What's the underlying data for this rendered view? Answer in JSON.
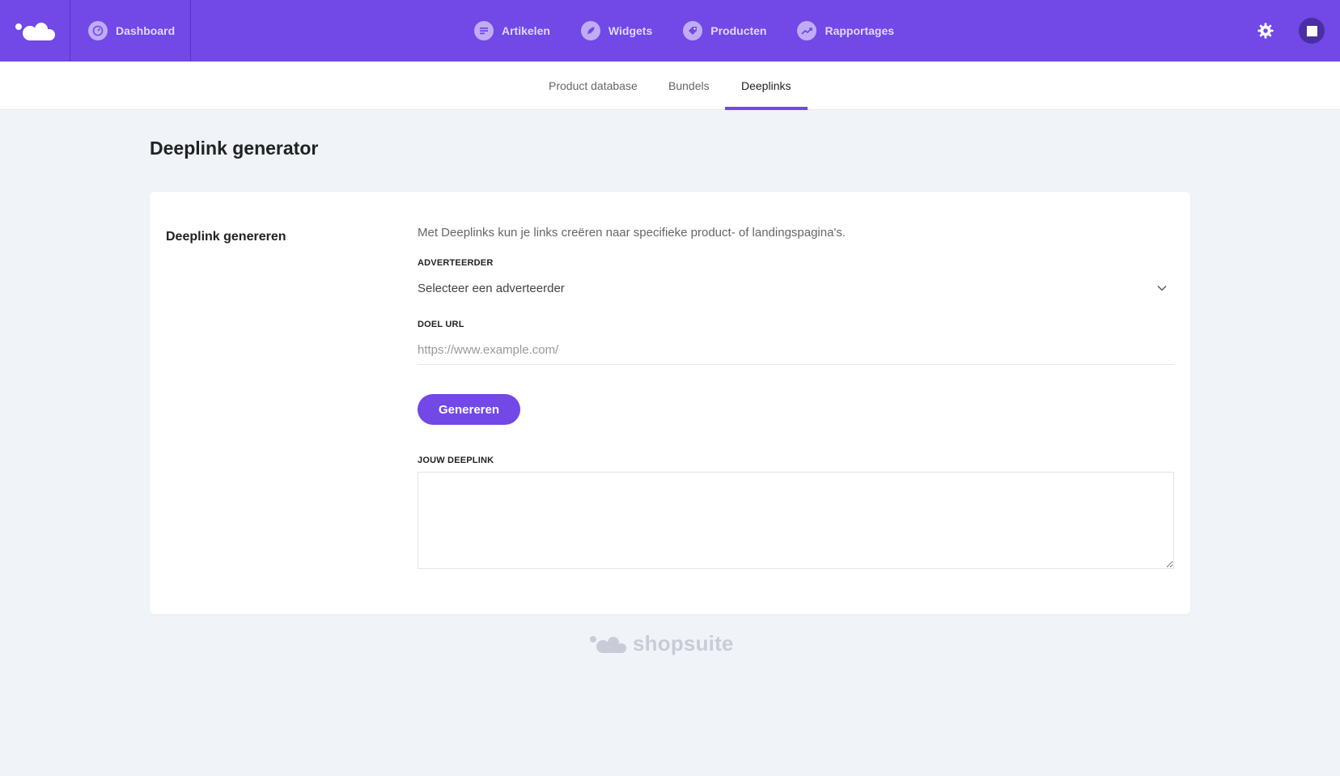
{
  "topbar": {
    "dashboard_label": "Dashboard",
    "nav": [
      {
        "label": "Artikelen",
        "icon": "list-icon"
      },
      {
        "label": "Widgets",
        "icon": "rocket-icon"
      },
      {
        "label": "Producten",
        "icon": "tag-icon"
      },
      {
        "label": "Rapportages",
        "icon": "trend-icon"
      }
    ],
    "accent": "#7248e6"
  },
  "subnav": {
    "tabs": [
      {
        "label": "Product database"
      },
      {
        "label": "Bundels"
      },
      {
        "label": "Deeplinks"
      }
    ],
    "active": "Deeplinks"
  },
  "page": {
    "title": "Deeplink generator"
  },
  "form": {
    "section_label": "Deeplink genereren",
    "intro": "Met Deeplinks kun je links creëren naar specifieke product- of landingspagina's.",
    "advertiser_label": "ADVERTEERDER",
    "advertiser_value": "Selecteer een adverteerder",
    "url_label": "DOEL URL",
    "url_placeholder": "https://www.example.com/",
    "button_label": "Genereren",
    "deeplink_label": "JOUW DEEPLINK"
  },
  "footer": {
    "brand": "shopsuite"
  }
}
